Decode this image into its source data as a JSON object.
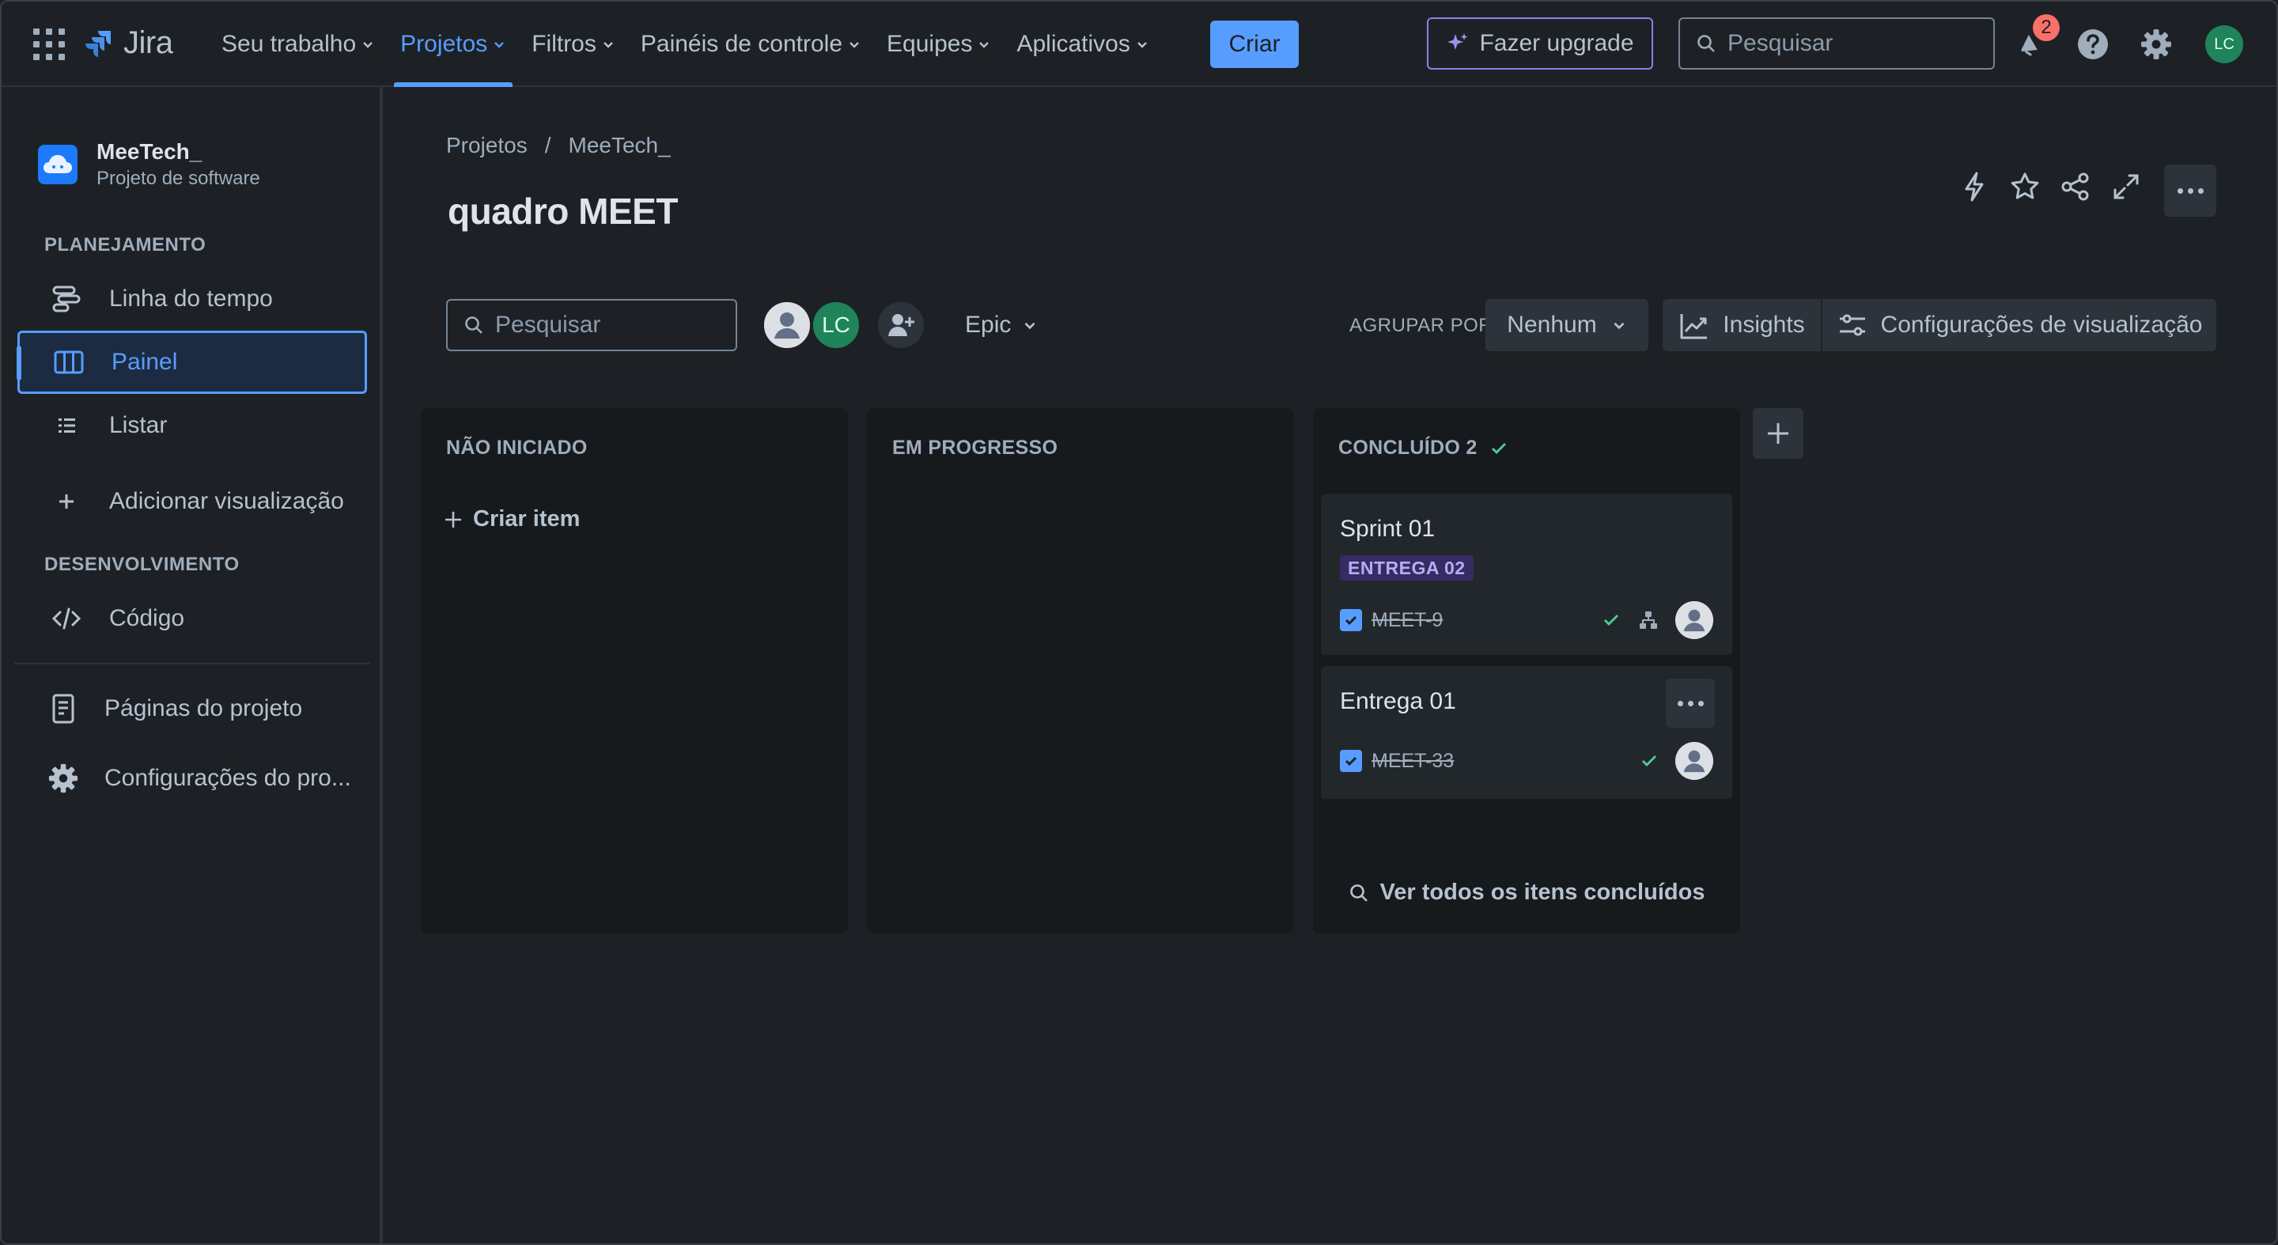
{
  "topnav": {
    "brand": "Jira",
    "items": [
      {
        "label": "Seu trabalho"
      },
      {
        "label": "Projetos"
      },
      {
        "label": "Filtros"
      },
      {
        "label": "Painéis de controle"
      },
      {
        "label": "Equipes"
      },
      {
        "label": "Aplicativos"
      }
    ],
    "active_item": "Projetos",
    "create_label": "Criar",
    "upgrade_label": "Fazer upgrade",
    "search_placeholder": "Pesquisar",
    "notification_count": "2",
    "user_initials": "LC"
  },
  "sidebar": {
    "project_name": "MeeTech_",
    "project_type": "Projeto de software",
    "planning_header": "PLANEJAMENTO",
    "planning_items": [
      {
        "label": "Linha do tempo",
        "icon": "timeline-icon"
      },
      {
        "label": "Painel",
        "icon": "board-icon",
        "active": true
      },
      {
        "label": "Listar",
        "icon": "list-icon"
      }
    ],
    "add_view_label": "Adicionar visualização",
    "development_header": "DESENVOLVIMENTO",
    "code_label": "Código",
    "project_pages_label": "Páginas do projeto",
    "project_settings_label": "Configurações do pro..."
  },
  "main": {
    "breadcrumb": [
      "Projetos",
      "/",
      "MeeTech_"
    ],
    "title": "quadro MEET",
    "search_placeholder": "Pesquisar",
    "avatar_initials": "LC",
    "epic_filter_label": "Epic",
    "group_by_label": "AGRUPAR POR",
    "group_by_value": "Nenhum",
    "insights_label": "Insights",
    "view_settings_label": "Configurações de visualização"
  },
  "columns": [
    {
      "title": "NÃO INICIADO",
      "create_label": "Criar item"
    },
    {
      "title": "EM PROGRESSO"
    },
    {
      "title": "CONCLUÍDO 2",
      "cards": [
        {
          "title": "Sprint 01",
          "epic": "ENTREGA 02",
          "key": "MEET-9"
        },
        {
          "title": "Entrega 01",
          "key": "MEET-33"
        }
      ],
      "see_all_label": "Ver todos os itens concluídos"
    }
  ],
  "colors": {
    "background": "#1d2125",
    "accent": "#579dff",
    "success": "#4bce97",
    "epic_bg": "#352c63",
    "epic_text": "#b8acf6",
    "avatar_green": "#1f845a",
    "badge": "#f87168"
  }
}
